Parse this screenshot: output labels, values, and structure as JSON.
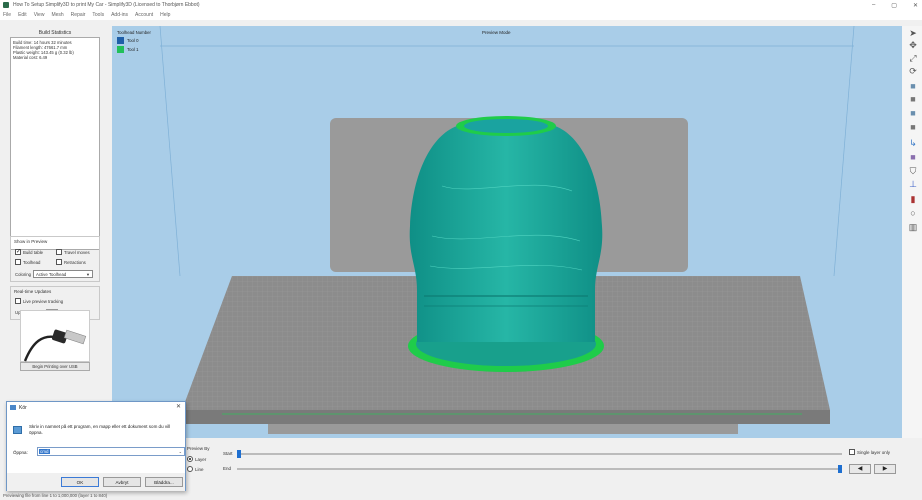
{
  "window": {
    "title": "How To Setup Simplify3D to print My Car - Simplify3D (Licensed to Thorbjørn Ebbot)",
    "controls": {
      "minimize": "–",
      "maximize": "▢",
      "close": "✕"
    }
  },
  "menu": [
    "File",
    "Edit",
    "View",
    "Mesh",
    "Repair",
    "Tools",
    "Add-ins",
    "Account",
    "Help"
  ],
  "build_statistics": {
    "title": "Build Statistics",
    "lines": [
      "Build time: 14 hours 32 minutes",
      "Filament length: 47661.7 mm",
      "Plastic weight: 143.45 g (0.32 lb)",
      "Material cost: 6.49"
    ]
  },
  "show_in_preview": {
    "title": "Show in Preview",
    "build_table": {
      "label": "Build table",
      "checked": true
    },
    "travel_moves": {
      "label": "Travel moves",
      "checked": false
    },
    "toolhead": {
      "label": "Toolhead",
      "checked": false
    },
    "retractions": {
      "label": "Retractions",
      "checked": false
    },
    "coloring_label": "Coloring",
    "coloring_value": "Active Toolhead"
  },
  "realtime": {
    "title": "Real-time Updates",
    "live_preview": {
      "label": "Live preview tracking",
      "checked": false
    },
    "interval_label": "Update interval",
    "interval_value": "1.0",
    "interval_unit": "sec"
  },
  "usb_button": "Begin Printing over USB",
  "viewport": {
    "mode": "Preview Mode",
    "legend_title": "Toolhead Number",
    "legend": [
      {
        "label": "Tool 0",
        "color": "#1f5fa8"
      },
      {
        "label": "Tool 1",
        "color": "#21c05a"
      }
    ],
    "colors": {
      "background": "#a9cde8",
      "bed": "#8a8a8a",
      "backplate": "#9a9a9a",
      "tool0": "#1aa3a0",
      "tool1": "#1fcc4a"
    }
  },
  "preview_by": {
    "title": "Preview By",
    "layer": {
      "label": "Layer",
      "selected": true
    },
    "line": {
      "label": "Line",
      "selected": false
    },
    "start_label": "Start",
    "end_label": "End",
    "start_position": 0.0,
    "end_position": 1.0,
    "single_layer": {
      "label": "Single layer only",
      "checked": false
    },
    "prev_icon": "◀",
    "next_icon": "▶"
  },
  "status": "Previewing file from line 1 to 1,000,000 (layer 1 to 840)",
  "run_dialog": {
    "title": "Kör",
    "close": "✕",
    "description": "Skriv in namnet på ett program, en mapp eller ett dokument som du vill öppna.",
    "open_label": "Öppna:",
    "open_value": "cmd",
    "ok": "OK",
    "cancel": "Avbryt",
    "browse": "Bläddra..."
  },
  "toolbar_icons": [
    "cursor-icon",
    "move-icon",
    "scale-icon",
    "rotate-icon",
    "view-front-icon",
    "view-top-icon",
    "view-side-icon",
    "view-iso-icon",
    "axis-icon",
    "cube-icon",
    "support-icon",
    "anchor-icon",
    "cross-section-icon",
    "circle-icon",
    "tower-icon"
  ]
}
